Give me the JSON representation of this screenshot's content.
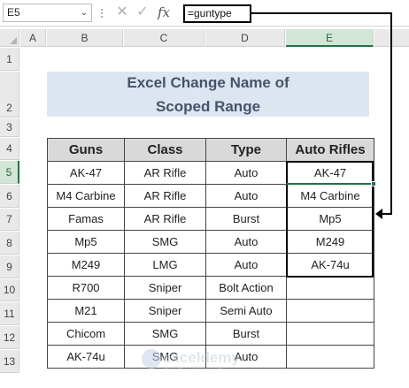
{
  "formula_bar": {
    "name_box": "E5",
    "formula": "=guntype",
    "cancel_glyph": "✕",
    "enter_glyph": "✓",
    "fx_label": "fx"
  },
  "columns": [
    "A",
    "B",
    "C",
    "D",
    "E"
  ],
  "selected_column": "E",
  "rows": [
    "1",
    "2",
    "3",
    "4",
    "5",
    "6",
    "7",
    "8",
    "9",
    "10",
    "11",
    "12",
    "13"
  ],
  "selected_rows": [
    "5"
  ],
  "title": {
    "line1": "Excel Change Name of",
    "line2": "Scoped Range"
  },
  "table": {
    "headers": [
      "Guns",
      "Class",
      "Type",
      "Auto Rifles"
    ],
    "rows": [
      [
        "AK-47",
        "AR Rifle",
        "Auto",
        "AK-47"
      ],
      [
        "M4 Carbine",
        "AR Rifle",
        "Auto",
        "M4 Carbine"
      ],
      [
        "Famas",
        "AR Rifle",
        "Burst",
        "Mp5"
      ],
      [
        "Mp5",
        "SMG",
        "Auto",
        "M249"
      ],
      [
        "M249",
        "LMG",
        "Auto",
        "AK-74u"
      ],
      [
        "R700",
        "Sniper",
        "Bolt Action",
        ""
      ],
      [
        "M21",
        "Sniper",
        "Semi Auto",
        ""
      ],
      [
        "Chicom",
        "SMG",
        "Burst",
        ""
      ],
      [
        "AK-74u",
        "SMG",
        "Auto",
        ""
      ]
    ]
  },
  "watermark": {
    "name": "exceldemy",
    "tagline": "EXCEL · DATA · BI"
  },
  "colors": {
    "title_bg": "#dce6f1",
    "title_text": "#44546a",
    "header_bg": "#d9d9d9",
    "selection_green": "#217346"
  }
}
